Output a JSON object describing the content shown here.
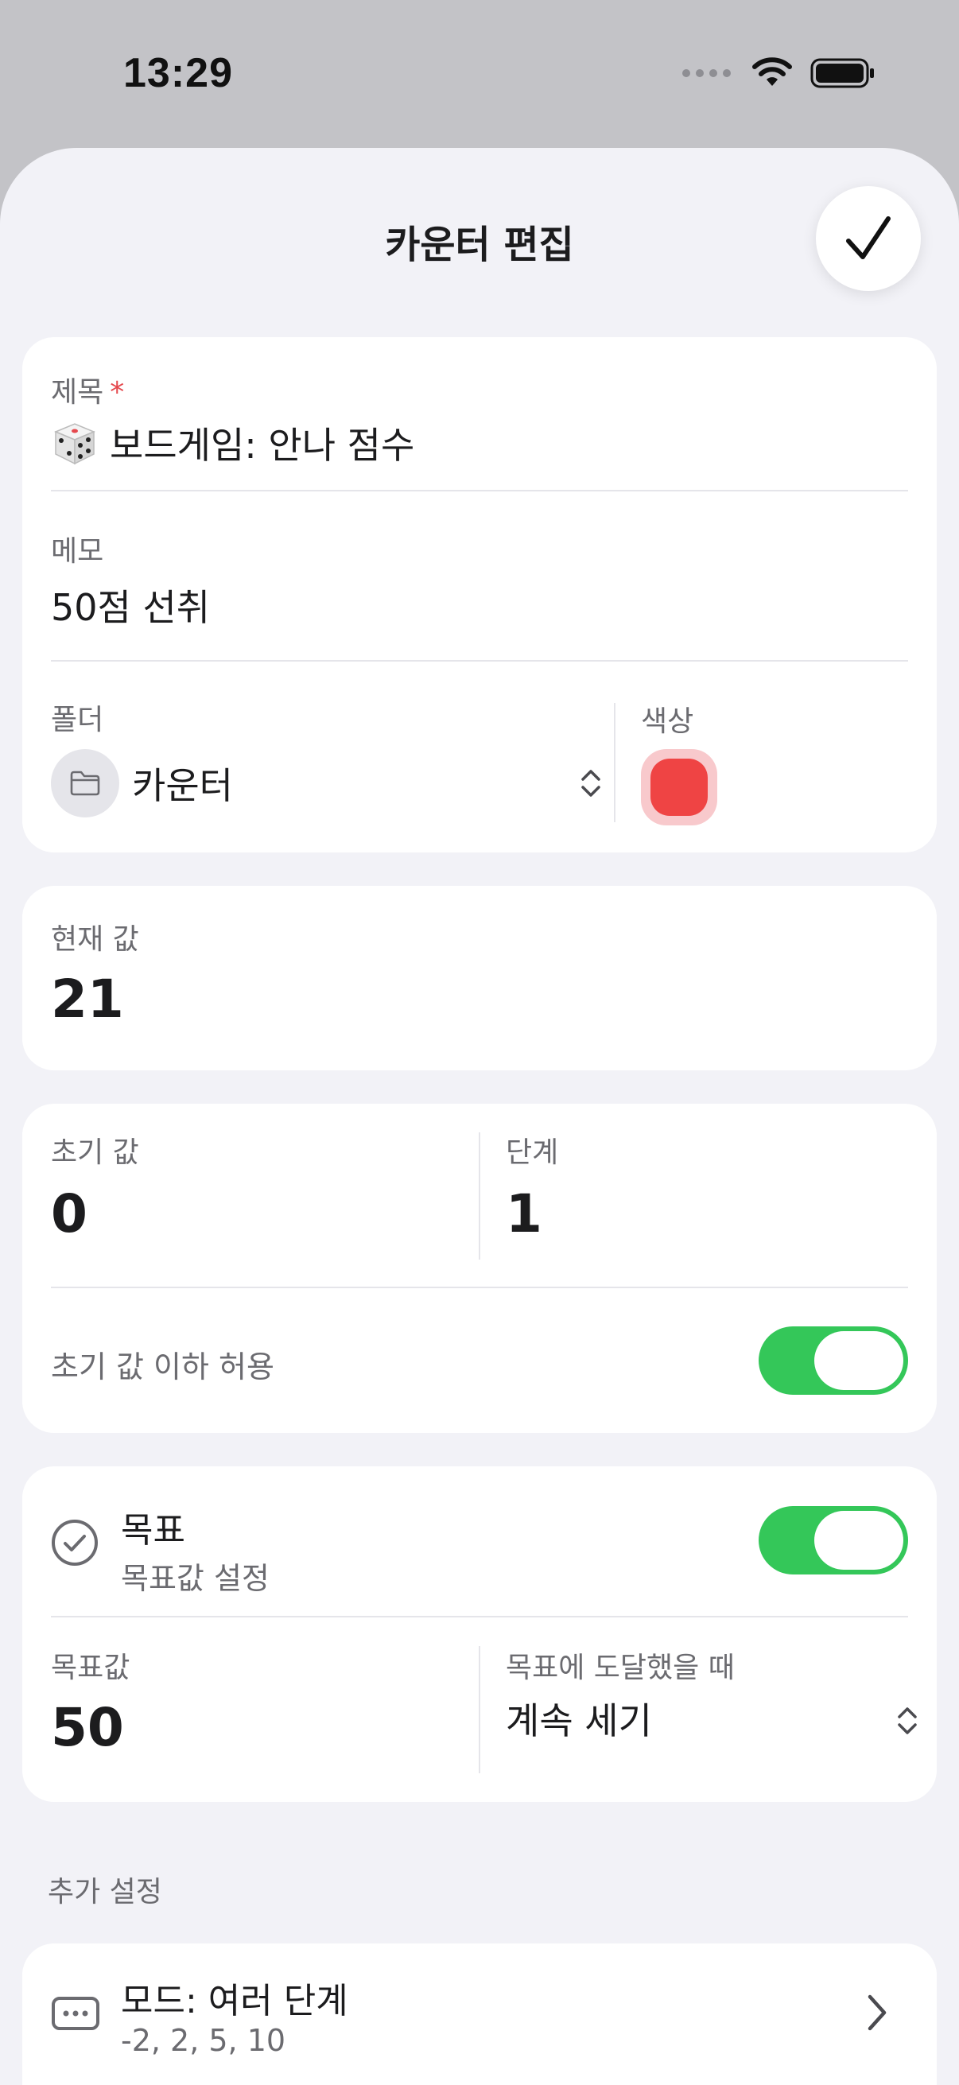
{
  "status_bar": {
    "time": "13:29"
  },
  "header": {
    "title": "카운터 편집"
  },
  "title_field": {
    "label": "제목",
    "required_mark": "*",
    "value": "보드게임: 안나 점수"
  },
  "memo_field": {
    "label": "메모",
    "value": "50점 선취"
  },
  "folder_field": {
    "label": "폴더",
    "value": "카운터"
  },
  "color_field": {
    "label": "색상",
    "color": "#ef4444"
  },
  "current_value": {
    "label": "현재 값",
    "value": "21"
  },
  "initial_value": {
    "label": "초기 값",
    "value": "0"
  },
  "step_value": {
    "label": "단계",
    "value": "1"
  },
  "allow_below_initial": {
    "label": "초기 값 이하 허용",
    "enabled": true
  },
  "goal": {
    "title": "목표",
    "subtitle": "목표값 설정",
    "enabled": true
  },
  "goal_value": {
    "label": "목표값",
    "value": "50"
  },
  "goal_reached": {
    "label": "목표에 도달했을 때",
    "value": "계속 세기"
  },
  "additional_settings": {
    "section_label": "추가 설정"
  },
  "mode": {
    "title": "모드: 여러 단계",
    "subtitle": "-2, 2, 5, 10"
  },
  "colors": {
    "accent_green": "#34c759",
    "sheet_bg": "#f2f2f7",
    "card_bg": "#ffffff"
  }
}
